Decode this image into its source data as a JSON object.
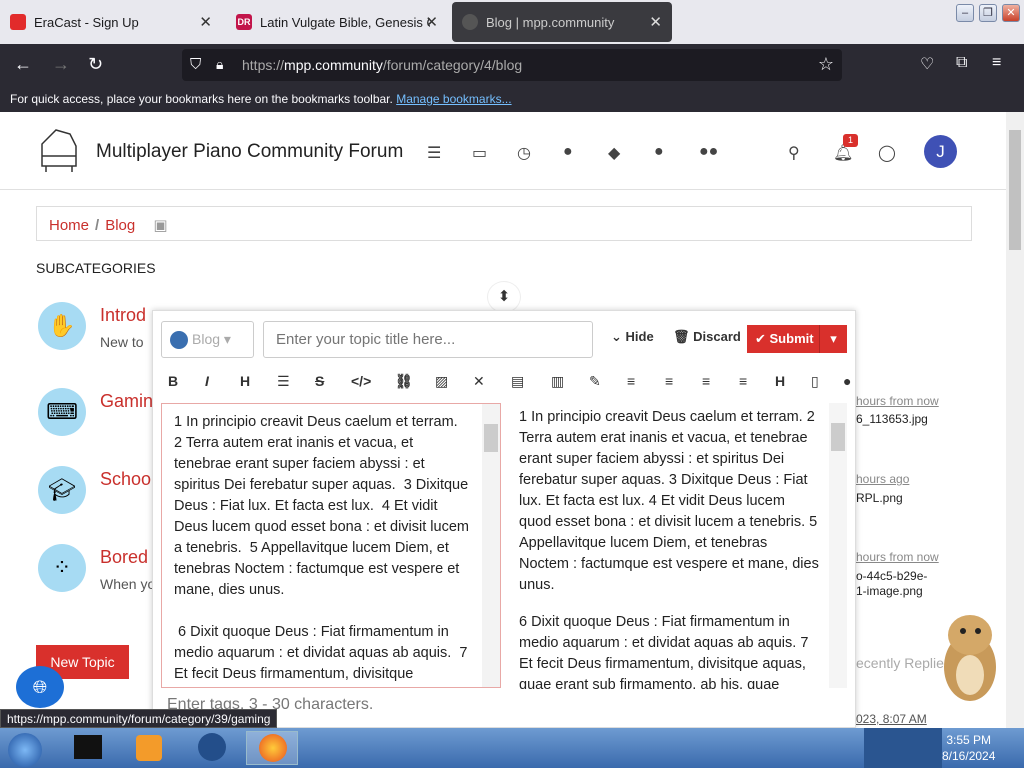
{
  "browser": {
    "tabs": [
      {
        "title": "EraCast - Sign Up",
        "color": "#e22b2b"
      },
      {
        "title": "Latin Vulgate Bible, Genesis Ch",
        "color": "#c2154a",
        "badge": "DR"
      },
      {
        "title": "Blog | mpp.community",
        "color": "#888888"
      }
    ],
    "url_prefix": "https://",
    "url_host": "mpp.community",
    "url_path": "/forum/category/4/blog",
    "bookmarks_text": "For quick access, place your bookmarks here on the bookmarks toolbar.",
    "bookmarks_link": "Manage bookmarks..."
  },
  "site": {
    "title": "Multiplayer Piano Community Forum",
    "notification_count": "1",
    "avatar_letter": "J",
    "breadcrumb": {
      "home": "Home",
      "current": "Blog"
    },
    "subcategories_label": "SUBCATEGORIES",
    "categories": [
      {
        "title": "Introd",
        "desc": "New to"
      },
      {
        "title": "Gamin",
        "desc": ""
      },
      {
        "title": "Schoo",
        "desc": ""
      },
      {
        "title": "Bored",
        "desc": "When yo"
      }
    ],
    "new_topic_label": "New Topic",
    "right_column": {
      "r1_time": "hours from now",
      "r1_file": "6_113653.jpg",
      "r2_time": "hours ago",
      "r2_file": "RPL.png",
      "r3_time": "hours from now",
      "r3_file1": "o-44c5-b29e-",
      "r3_file2": "1-image.png",
      "sort_label": "ecently Replied",
      "last_date": "023, 8:07 AM"
    }
  },
  "composer": {
    "category": "Blog",
    "title_placeholder": "Enter your topic title here...",
    "hide_label": "Hide",
    "discard_label": "Discard",
    "submit_label": "Submit",
    "editor_text": "1 In principio creavit Deus caelum et terram.\n2 Terra autem erat inanis et vacua, et tenebrae erant super faciem abyssi : et spiritus Dei ferebatur super aquas.  3 Dixitque Deus : Fiat lux. Et facta est lux.  4 Et vidit Deus lucem quod esset bona : et divisit lucem a tenebris.  5 Appellavitque lucem Diem, et tenebras Noctem : factumque est vespere et mane, dies unus.\n\n 6 Dixit quoque Deus : Fiat firmamentum in medio aquarum : et dividat aquas ab aquis.  7 Et fecit Deus firmamentum, divisitque",
    "preview_p1": "1 In principio creavit Deus caelum et terram. 2 Terra autem erat inanis et vacua, et tenebrae erant super faciem abyssi : et spiritus Dei ferebatur super aquas. 3 Dixitque Deus : Fiat lux. Et facta est lux. 4 Et vidit Deus lucem quod esset bona : et divisit lucem a tenebris. 5 Appellavitque lucem Diem, et tenebras Noctem : factumque est vespere et mane, dies unus.",
    "preview_p2": "6 Dixit quoque Deus : Fiat firmamentum in medio aquarum : et dividat aquas ab aquis. 7 Et fecit Deus firmamentum, divisitque aquas, quae erant sub firmamento, ab his, quae",
    "tags_placeholder": "Enter tags, 3 - 30 characters."
  },
  "status_url": "https://mpp.community/forum/category/39/gaming",
  "clock": {
    "time": "3:55 PM",
    "date": "8/16/2024"
  },
  "colors": {
    "accent": "#d9302c",
    "avatar": "#3f51b5",
    "category_bg": "#a7dbf3"
  }
}
